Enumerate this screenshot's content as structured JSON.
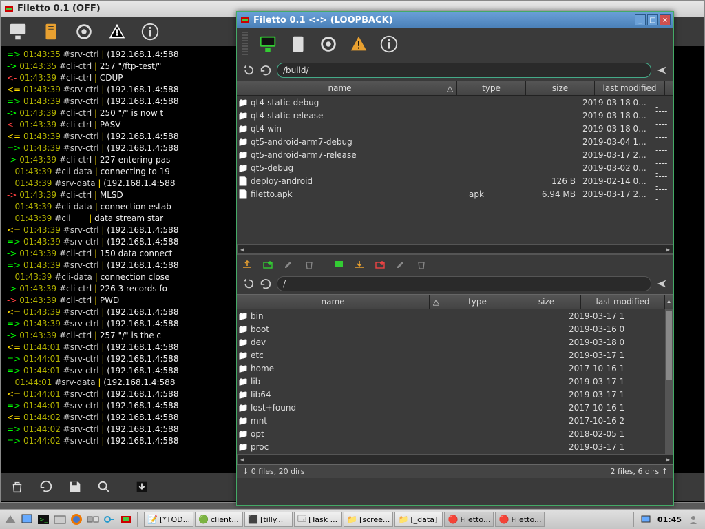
{
  "bg": {
    "title": "Filetto 0.1 (OFF)",
    "log": [
      {
        "arr": "=>",
        "cls": "arr-g",
        "ts": "01:43:35",
        "tag": "#srv-ctrl",
        "msg": "(192.168.1.4:588"
      },
      {
        "arr": "->",
        "cls": "arr-g",
        "ts": "01:43:35",
        "tag": "#cli-ctrl",
        "msg": "257 \"/ftp-test/\""
      },
      {
        "arr": "<-",
        "cls": "arr-r",
        "ts": "01:43:39",
        "tag": "#cli-ctrl",
        "msg": "CDUP"
      },
      {
        "arr": "<=",
        "cls": "arr-y",
        "ts": "01:43:39",
        "tag": "#srv-ctrl",
        "msg": "(192.168.1.4:588"
      },
      {
        "arr": "=>",
        "cls": "arr-g",
        "ts": "01:43:39",
        "tag": "#srv-ctrl",
        "msg": "(192.168.1.4:588"
      },
      {
        "arr": "->",
        "cls": "arr-g",
        "ts": "01:43:39",
        "tag": "#cli-ctrl",
        "msg": "250 \"/\" is now t"
      },
      {
        "arr": "<-",
        "cls": "arr-r",
        "ts": "01:43:39",
        "tag": "#cli-ctrl",
        "msg": "PASV"
      },
      {
        "arr": "<=",
        "cls": "arr-y",
        "ts": "01:43:39",
        "tag": "#srv-ctrl",
        "msg": "(192.168.1.4:588"
      },
      {
        "arr": "=>",
        "cls": "arr-g",
        "ts": "01:43:39",
        "tag": "#srv-ctrl",
        "msg": "(192.168.1.4:588"
      },
      {
        "arr": "->",
        "cls": "arr-g",
        "ts": "01:43:39",
        "tag": "#cli-ctrl",
        "msg": "227 entering pas"
      },
      {
        "arr": "  ",
        "cls": "msg",
        "ts": "01:43:39",
        "tag": "#cli-data",
        "msg": "connecting to 19"
      },
      {
        "arr": "  ",
        "cls": "msg",
        "ts": "01:43:39",
        "tag": "#srv-data",
        "msg": "(192.168.1.4:588"
      },
      {
        "arr": "->",
        "cls": "arr-r",
        "ts": "01:43:39",
        "tag": "#cli-ctrl",
        "msg": "MLSD"
      },
      {
        "arr": "  ",
        "cls": "msg",
        "ts": "01:43:39",
        "tag": "#cli-data",
        "msg": "connection estab"
      },
      {
        "arr": "  ",
        "cls": "msg",
        "ts": "01:43:39",
        "tag": "#cli      ",
        "msg": "data stream star"
      },
      {
        "arr": "<=",
        "cls": "arr-y",
        "ts": "01:43:39",
        "tag": "#srv-ctrl",
        "msg": "(192.168.1.4:588"
      },
      {
        "arr": "=>",
        "cls": "arr-g",
        "ts": "01:43:39",
        "tag": "#srv-ctrl",
        "msg": "(192.168.1.4:588"
      },
      {
        "arr": "->",
        "cls": "arr-g",
        "ts": "01:43:39",
        "tag": "#cli-ctrl",
        "msg": "150 data connect"
      },
      {
        "arr": "=>",
        "cls": "arr-g",
        "ts": "01:43:39",
        "tag": "#srv-ctrl",
        "msg": "(192.168.1.4:588"
      },
      {
        "arr": "  ",
        "cls": "msg",
        "ts": "01:43:39",
        "tag": "#cli-data",
        "msg": "connection close"
      },
      {
        "arr": "->",
        "cls": "arr-g",
        "ts": "01:43:39",
        "tag": "#cli-ctrl",
        "msg": "226 3 records fo"
      },
      {
        "arr": "->",
        "cls": "arr-r",
        "ts": "01:43:39",
        "tag": "#cli-ctrl",
        "msg": "PWD"
      },
      {
        "arr": "<=",
        "cls": "arr-y",
        "ts": "01:43:39",
        "tag": "#srv-ctrl",
        "msg": "(192.168.1.4:588"
      },
      {
        "arr": "=>",
        "cls": "arr-g",
        "ts": "01:43:39",
        "tag": "#srv-ctrl",
        "msg": "(192.168.1.4:588"
      },
      {
        "arr": "->",
        "cls": "arr-g",
        "ts": "01:43:39",
        "tag": "#cli-ctrl",
        "msg": "257 \"/\" is the c"
      },
      {
        "arr": "<=",
        "cls": "arr-y",
        "ts": "01:44:01",
        "tag": "#srv-ctrl",
        "msg": "(192.168.1.4:588"
      },
      {
        "arr": "=>",
        "cls": "arr-g",
        "ts": "01:44:01",
        "tag": "#srv-ctrl",
        "msg": "(192.168.1.4:588"
      },
      {
        "arr": "=>",
        "cls": "arr-g",
        "ts": "01:44:01",
        "tag": "#srv-ctrl",
        "msg": "(192.168.1.4:588"
      },
      {
        "arr": "  ",
        "cls": "msg",
        "ts": "01:44:01",
        "tag": "#srv-data",
        "msg": "(192.168.1.4:588"
      },
      {
        "arr": "<=",
        "cls": "arr-y",
        "ts": "01:44:01",
        "tag": "#srv-ctrl",
        "msg": "(192.168.1.4:588"
      },
      {
        "arr": "=>",
        "cls": "arr-g",
        "ts": "01:44:01",
        "tag": "#srv-ctrl",
        "msg": "(192.168.1.4:588"
      },
      {
        "arr": "<=",
        "cls": "arr-y",
        "ts": "01:44:02",
        "tag": "#srv-ctrl",
        "msg": "(192.168.1.4:588"
      },
      {
        "arr": "=>",
        "cls": "arr-g",
        "ts": "01:44:02",
        "tag": "#srv-ctrl",
        "msg": "(192.168.1.4:588"
      },
      {
        "arr": "=>",
        "cls": "arr-g",
        "ts": "01:44:02",
        "tag": "#srv-ctrl",
        "msg": "(192.168.1.4:588"
      }
    ]
  },
  "fg": {
    "title": "Filetto 0.1 <-> (LOOPBACK)",
    "path_top": "/build/",
    "path_bottom": "/",
    "cols": {
      "name": "name",
      "type": "type",
      "size": "size",
      "modified": "last modified"
    },
    "top_files": [
      {
        "icon": "folder",
        "name": "qt4-static-debug",
        "type": "",
        "size": "",
        "date": "2019-03-18 0...",
        "perm": "-----"
      },
      {
        "icon": "folder",
        "name": "qt4-static-release",
        "type": "",
        "size": "",
        "date": "2019-03-18 0...",
        "perm": "-----"
      },
      {
        "icon": "folder",
        "name": "qt4-win",
        "type": "",
        "size": "",
        "date": "2019-03-18 0...",
        "perm": "-----"
      },
      {
        "icon": "folder",
        "name": "qt5-android-arm7-debug",
        "type": "",
        "size": "",
        "date": "2019-03-04 1...",
        "perm": "-----"
      },
      {
        "icon": "folder",
        "name": "qt5-android-arm7-release",
        "type": "",
        "size": "",
        "date": "2019-03-17 2...",
        "perm": "-----"
      },
      {
        "icon": "folder",
        "name": "qt5-debug",
        "type": "",
        "size": "",
        "date": "2019-03-02 0...",
        "perm": "-----"
      },
      {
        "icon": "file",
        "name": "deploy-android",
        "type": "",
        "size": "126 B",
        "date": "2019-02-14 0...",
        "perm": "-----"
      },
      {
        "icon": "file",
        "name": "filetto.apk",
        "type": "apk",
        "size": "6.94 MB",
        "date": "2019-03-17 2...",
        "perm": "-----"
      }
    ],
    "bottom_files": [
      {
        "icon": "folder",
        "name": "bin",
        "date": "2019-03-17 1"
      },
      {
        "icon": "folder",
        "name": "boot",
        "date": "2019-03-16 0"
      },
      {
        "icon": "folder",
        "name": "dev",
        "date": "2019-03-18 0"
      },
      {
        "icon": "folder",
        "name": "etc",
        "date": "2019-03-17 1"
      },
      {
        "icon": "folder",
        "name": "home",
        "date": "2017-10-16 1"
      },
      {
        "icon": "folder",
        "name": "lib",
        "date": "2019-03-17 1"
      },
      {
        "icon": "folder",
        "name": "lib64",
        "date": "2019-03-17 1"
      },
      {
        "icon": "folder",
        "name": "lost+found",
        "date": "2017-10-16 1"
      },
      {
        "icon": "folder",
        "name": "mnt",
        "date": "2017-10-16 2"
      },
      {
        "icon": "folder",
        "name": "opt",
        "date": "2018-02-05 1"
      },
      {
        "icon": "folder",
        "name": "proc",
        "date": "2019-03-17 1"
      }
    ],
    "status_left": "↓ 0 files, 20 dirs",
    "status_right": "2 files, 6 dirs ↑"
  },
  "taskbar": {
    "items": [
      {
        "label": "[*TOD..."
      },
      {
        "label": "client..."
      },
      {
        "label": "[tilly..."
      },
      {
        "label": "[Task ..."
      },
      {
        "label": "[scree..."
      },
      {
        "label": "[_data]"
      },
      {
        "label": "Filetto..."
      },
      {
        "label": "Filetto..."
      }
    ],
    "clock": "01:45"
  }
}
